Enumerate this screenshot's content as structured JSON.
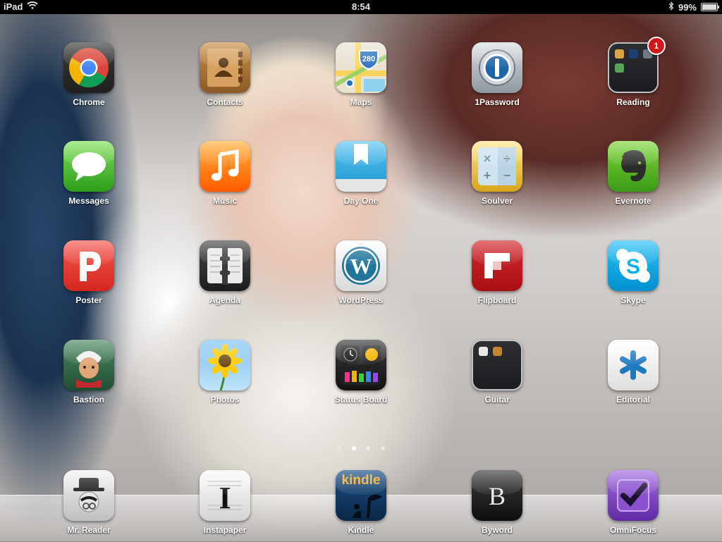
{
  "status_bar": {
    "device": "iPad",
    "time": "8:54",
    "battery_percent": "99%",
    "battery_level": 0.99,
    "wifi_icon": "wifi-icon",
    "bluetooth_icon": "bluetooth-icon"
  },
  "apps": {
    "chrome": "Chrome",
    "contacts": "Contacts",
    "maps": "Maps",
    "maps_shield": "280",
    "onepassword": "1Password",
    "reading": "Reading",
    "reading_badge": "1",
    "messages": "Messages",
    "music": "Music",
    "dayone": "Day One",
    "soulver": "Soulver",
    "evernote": "Evernote",
    "poster": "Poster",
    "agenda": "Agenda",
    "wordpress": "WordPress",
    "flipboard": "Flipboard",
    "skype": "Skype",
    "bastion": "Bastion",
    "photos": "Photos",
    "statusboard": "Status Board",
    "guitar": "Guitar",
    "editorial": "Editorial"
  },
  "dock": {
    "mrreader": "Mr. Reader",
    "instapaper": "Instapaper",
    "kindle": "Kindle",
    "kindle_wordmark": "kindle",
    "byword": "Byword",
    "omnifocus": "OmniFocus"
  },
  "page_control": {
    "pages": 3,
    "current": 1
  },
  "colors": {
    "chrome_red": "#db4437",
    "messages_green": "#4cd137",
    "music_orange": "#ff6a00",
    "dayone_blue": "#2fa9e0",
    "evernote_green": "#5fbf2a",
    "poster_red": "#e9342c",
    "flipboard_red": "#c4161c",
    "skype_blue": "#00aff0",
    "omnifocus_purple": "#7b3fbf",
    "badge_red": "#d1161b"
  }
}
